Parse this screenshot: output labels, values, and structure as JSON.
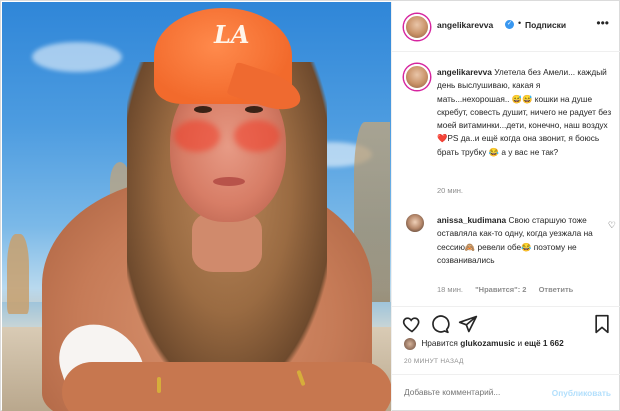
{
  "header": {
    "username": "angelikarevva",
    "separator": "•",
    "follow_label": "Подписки",
    "more_label": "•••"
  },
  "caption": {
    "username": "angelikarevva",
    "text": "Улетела без Амели... каждый день выслушиваю, какая я мать...нехорошая.. 😅😅 кошки на душе скребут, совесть душит, ничего не радует без моей витаминки...дети, конечно, наш воздух❤️PS да..и ещё когда она звонит, я боюсь брать трубку 😂 а у вас не так?",
    "time": "20 мин."
  },
  "comment": {
    "username": "anissa_kudimana",
    "text": "Свою старшую тоже оставляла как-то одну, когда уезжала на сессию🙈 ревели обе😂 поэтому не созванивались",
    "time": "18 мин.",
    "likes_label": "\"Нравится\": 2",
    "reply_label": "Ответить"
  },
  "likes": {
    "prefix": "Нравится",
    "user": "glukozamusic",
    "connector": "и",
    "rest": "ещё 1 662"
  },
  "post_time": "20 МИНУТ НАЗАД",
  "add_comment": {
    "placeholder": "Добавьте комментарий...",
    "publish_label": "Опубликовать"
  },
  "photo": {
    "cap_logo": "LA"
  },
  "colors": {
    "verified": "#3897f0",
    "publish_disabled": "#b2dffc",
    "muted_text": "#8e8e8e"
  },
  "icons": [
    "verified-badge-icon",
    "heart-icon",
    "comment-icon",
    "share-icon",
    "bookmark-icon",
    "more-icon"
  ]
}
